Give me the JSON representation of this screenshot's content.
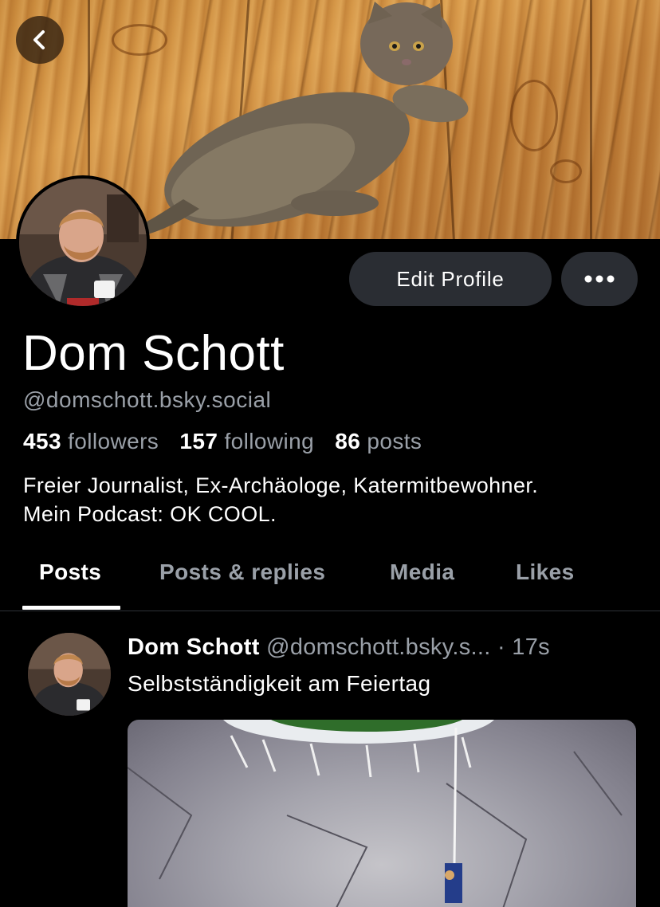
{
  "profile": {
    "display_name": "Dom Schott",
    "handle": "@domschott.bsky.social",
    "followers_count": "453",
    "followers_label": "followers",
    "following_count": "157",
    "following_label": "following",
    "posts_count": "86",
    "posts_label": "posts",
    "bio_line1": "Freier Journalist, Ex-Archäologe, Katermitbewohner.",
    "bio_line2": "Mein Podcast: OK COOL."
  },
  "actions": {
    "edit_profile_label": "Edit Profile",
    "more_icon": "ellipsis-icon",
    "back_icon": "chevron-left-icon"
  },
  "tabs": [
    {
      "label": "Posts",
      "active": true
    },
    {
      "label": "Posts & replies",
      "active": false
    },
    {
      "label": "Media",
      "active": false
    },
    {
      "label": "Likes",
      "active": false
    }
  ],
  "post": {
    "author_name": "Dom Schott",
    "author_handle": "@domschott.bsky.s...",
    "separator": "·",
    "timestamp": "17s",
    "text": "Selbstständigkeit am Feiertag"
  },
  "colors": {
    "background": "#000000",
    "button_bg": "#2a2d33",
    "muted_text": "#9aa0a8",
    "divider": "#2e3137"
  }
}
